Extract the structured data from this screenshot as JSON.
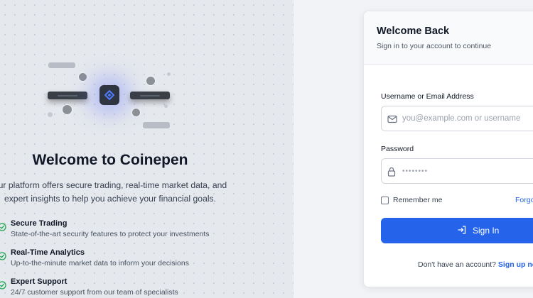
{
  "hero": {
    "title": "Welcome to Coinepen",
    "description_line1": "our platform offers secure trading, real-time market data, and",
    "description_line2": "expert insights to help you achieve your financial goals.",
    "features": [
      {
        "icon": "shield-check-icon",
        "title": "Secure Trading",
        "desc": "State-of-the-art security features to protect your investments"
      },
      {
        "icon": "shield-check-icon",
        "title": "Real-Time Analytics",
        "desc": "Up-to-the-minute market data to inform your decisions"
      },
      {
        "icon": "shield-check-icon",
        "title": "Expert Support",
        "desc": "24/7 customer support from our team of specialists"
      }
    ]
  },
  "login": {
    "title": "Welcome Back",
    "subtitle": "Sign in to your account to continue",
    "username_label": "Username or Email Address",
    "username_placeholder": "you@example.com or username",
    "password_label": "Password",
    "password_value": "••••••••",
    "remember_label": "Remember me",
    "forgot_link": "Forgot",
    "submit_label": "Sign In",
    "signup_prompt": "Don't have an account?",
    "signup_link": "Sign up no"
  },
  "colors": {
    "accent": "#2563eb",
    "left_bg": "#e5e8ed",
    "card_bg": "#ffffff"
  }
}
